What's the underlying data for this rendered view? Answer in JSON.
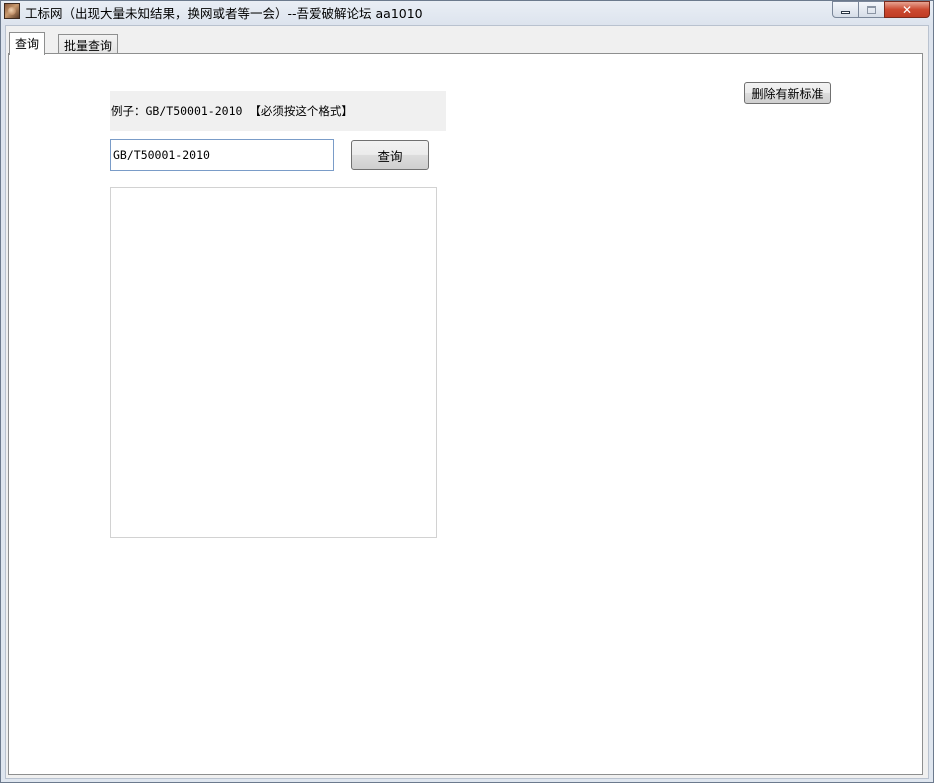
{
  "window": {
    "title": "工标网（出现大量未知结果，换网或者等一会）--吾爱破解论坛 aa1010",
    "icon": "app-icon",
    "controls": {
      "minimize_icon": "minimize-icon",
      "maximize_icon": "maximize-icon",
      "close_label": "✕"
    }
  },
  "tabs": [
    {
      "label": "查询",
      "active": true
    },
    {
      "label": "批量查询",
      "active": false
    }
  ],
  "query_tab": {
    "example_text": "例子：GB/T50001-2010  【必须按这个格式】",
    "input_value": "GB/T50001-2010",
    "query_button_label": "查询",
    "result_text": "",
    "delete_button_label": "删除有新标准"
  },
  "colors": {
    "input_border": "#7a9cc8",
    "panel_background": "#f0f0f0",
    "close_button": "#c03c23"
  }
}
